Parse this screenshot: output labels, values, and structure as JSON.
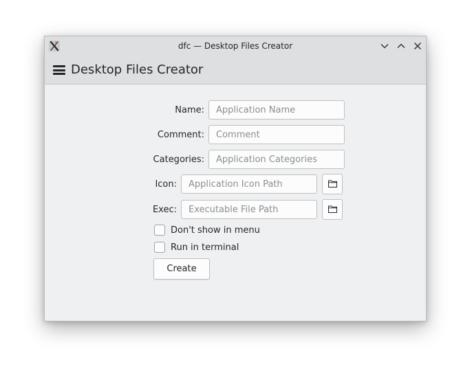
{
  "window": {
    "title": "dfc — Desktop Files Creator",
    "app_icon": "x-icon",
    "controls": [
      "minimize-icon",
      "maximize-icon",
      "close-icon"
    ]
  },
  "header": {
    "menu_icon": "hamburger-menu-icon",
    "title": "Desktop Files Creator"
  },
  "form": {
    "name": {
      "label": "Name:",
      "placeholder": "Application Name",
      "value": ""
    },
    "comment": {
      "label": "Comment:",
      "placeholder": "Comment",
      "value": ""
    },
    "categories": {
      "label": "Categories:",
      "placeholder": "Application Categories",
      "value": ""
    },
    "icon": {
      "label": "Icon:",
      "placeholder": "Application Icon Path",
      "value": "",
      "browse_icon": "folder-icon"
    },
    "exec": {
      "label": "Exec:",
      "placeholder": "Executable File Path",
      "value": "",
      "browse_icon": "folder-icon"
    },
    "no_display": {
      "label": "Don't show in menu",
      "checked": false
    },
    "terminal": {
      "label": "Run in terminal",
      "checked": false
    },
    "create_label": "Create"
  },
  "colors": {
    "window_bg": "#eff0f1",
    "titlebar_bg": "#dedfe1",
    "text": "#232629",
    "placeholder": "#8c8e90",
    "border": "#bdbfc1"
  }
}
